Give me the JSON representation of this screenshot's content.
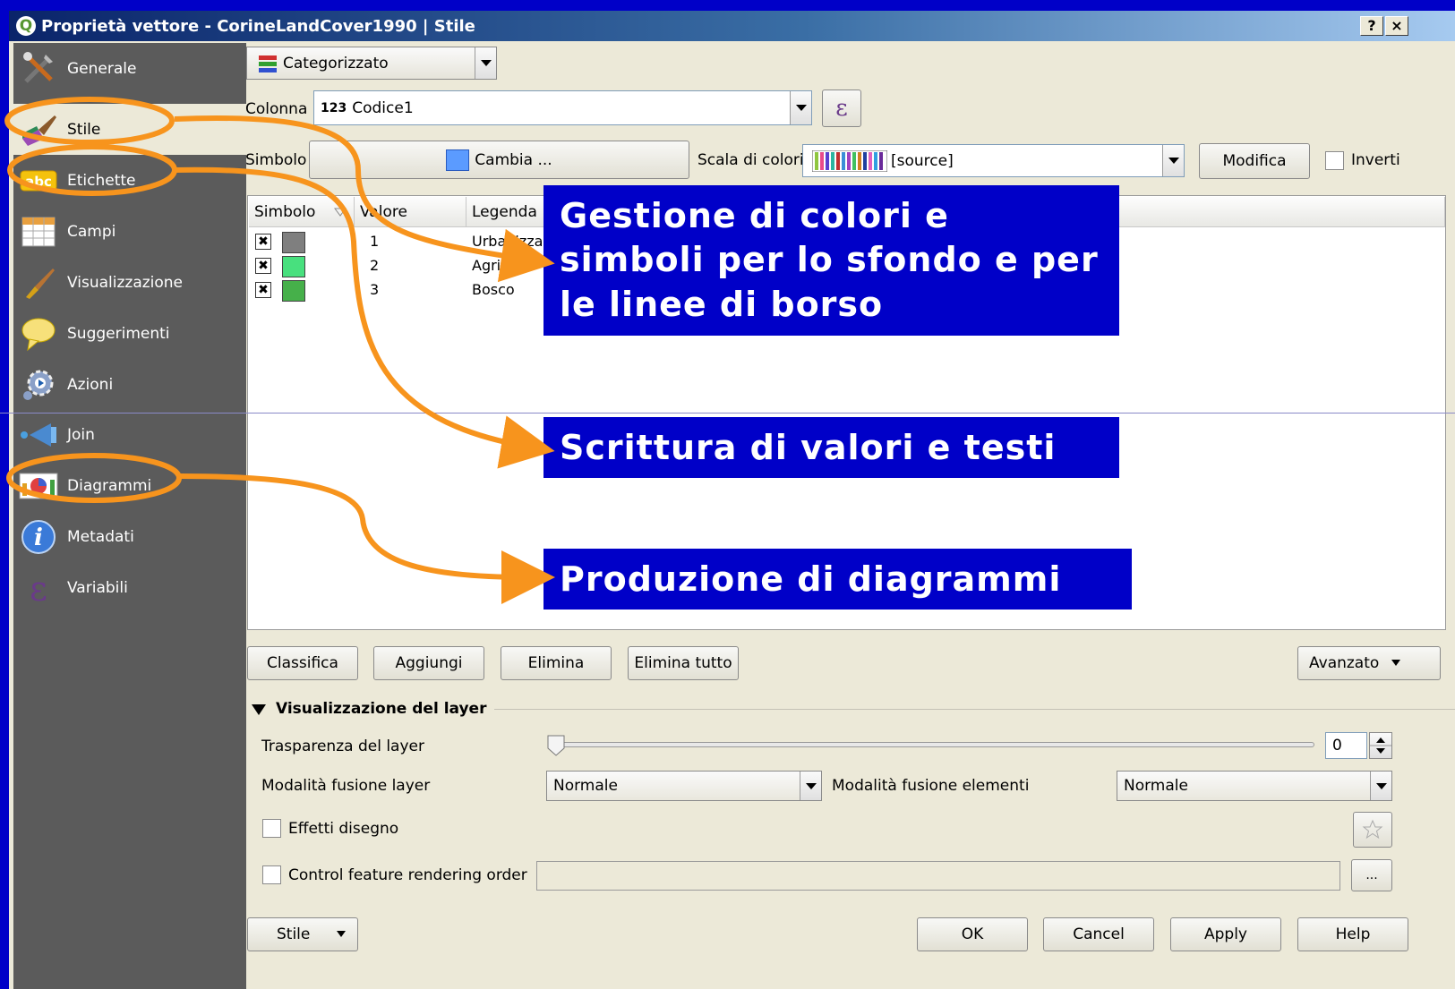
{
  "window": {
    "title": "Proprietà vettore - CorineLandCover1990 | Stile",
    "help_btn": "?",
    "close_btn": "×"
  },
  "sidebar": {
    "items": [
      {
        "label": "Generale",
        "icon": "generale-icon"
      },
      {
        "label": "Stile",
        "icon": "stile-icon"
      },
      {
        "label": "Etichette",
        "icon": "etichette-icon"
      },
      {
        "label": "Campi",
        "icon": "campi-icon"
      },
      {
        "label": "Visualizzazione",
        "icon": "visualizzazione-icon"
      },
      {
        "label": "Suggerimenti",
        "icon": "suggerimenti-icon"
      },
      {
        "label": "Azioni",
        "icon": "azioni-icon"
      },
      {
        "label": "Join",
        "icon": "join-icon"
      },
      {
        "label": "Diagrammi",
        "icon": "diagrammi-icon"
      },
      {
        "label": "Metadati",
        "icon": "metadati-icon"
      },
      {
        "label": "Variabili",
        "icon": "variabili-icon"
      }
    ],
    "active": "Stile"
  },
  "renderer": {
    "type": "Categorizzato"
  },
  "column": {
    "label": "Colonna",
    "type_badge": "123",
    "value": "Codice1",
    "expr_icon": "ε"
  },
  "symbol": {
    "label": "Simbolo",
    "change_btn": "Cambia ...",
    "color_scale_label": "Scala di colori",
    "color_scale_value": "[source]",
    "modify_btn": "Modifica",
    "invert_label": "Inverti"
  },
  "table": {
    "headers": [
      "Simbolo",
      "Valore",
      "Legenda"
    ],
    "rows": [
      {
        "value": "1",
        "legend": "Urbanizza",
        "color": "#7f7f7f"
      },
      {
        "value": "2",
        "legend": "Agricol",
        "color": "#48e07e"
      },
      {
        "value": "3",
        "legend": "Bosco",
        "color": "#46b04a"
      }
    ]
  },
  "actions": {
    "classify": "Classifica",
    "add": "Aggiungi",
    "delete": "Elimina",
    "delete_all": "Elimina tutto",
    "advanced": "Avanzato"
  },
  "layer_render": {
    "section_title": "Visualizzazione del layer",
    "transparency_label": "Trasparenza del layer",
    "transparency_value": "0",
    "blend_layer_label": "Modalità fusione layer",
    "blend_layer_value": "Normale",
    "blend_feature_label": "Modalità fusione elementi",
    "blend_feature_value": "Normale",
    "effects_label": "Effetti disegno",
    "order_label": "Control feature rendering order",
    "order_btn": "..."
  },
  "footer": {
    "style_btn": "Stile",
    "ok": "OK",
    "cancel": "Cancel",
    "apply": "Apply",
    "help": "Help"
  },
  "callouts": {
    "colors": "Gestione di colori e simboli per lo sfondo e per le linee di borso",
    "labels": "Scrittura di valori e testi",
    "diagrams": "Produzione di diagrammi"
  },
  "colors": {
    "slide_bg": "#0000c8",
    "highlight": "#f7941d",
    "sidebar_bg": "#5b5b5b"
  }
}
